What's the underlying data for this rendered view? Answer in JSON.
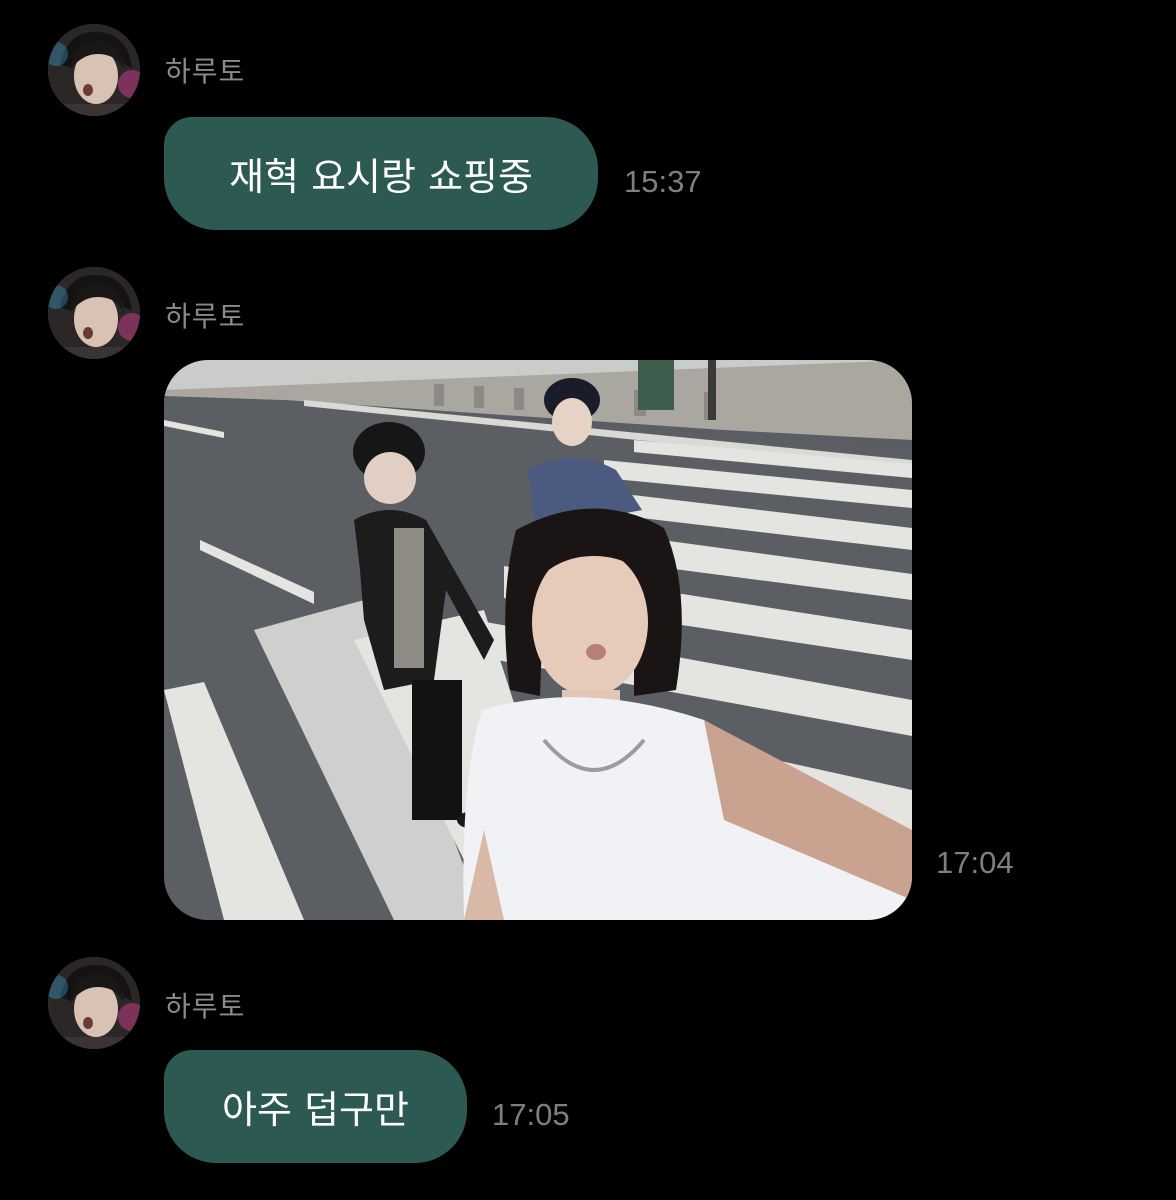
{
  "conversation": {
    "messages": [
      {
        "sender": "하루토",
        "type": "text",
        "text": "재혁 요시랑 쇼핑중",
        "time": "15:37"
      },
      {
        "sender": "하루토",
        "type": "photo",
        "time": "17:04"
      },
      {
        "sender": "하루토",
        "type": "text",
        "text": "아주 덥구만",
        "time": "17:05"
      }
    ]
  },
  "colors": {
    "background": "#000000",
    "bubble": "#2c5a52",
    "bubble_text": "#ffffff",
    "muted_text": "#8a8a8a"
  },
  "icons": {
    "avatar": "profile-photo",
    "photo": "street-selfie-photo"
  }
}
